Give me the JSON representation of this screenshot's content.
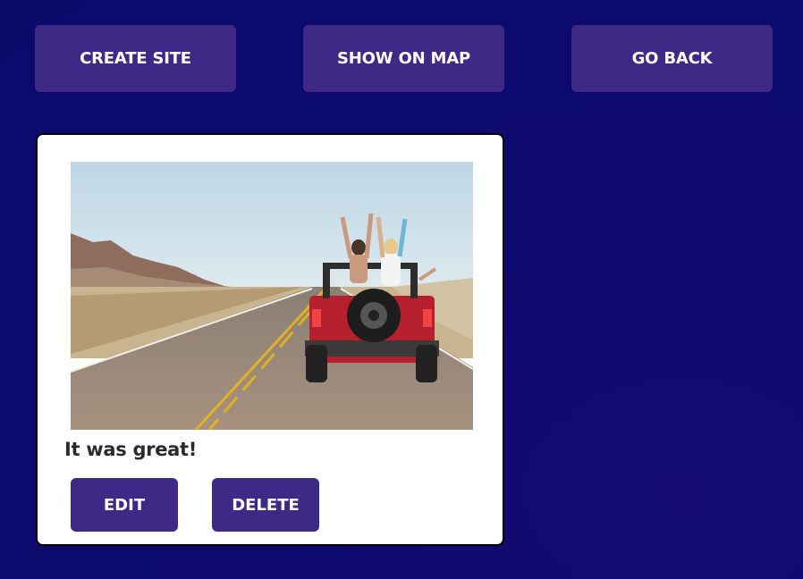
{
  "toolbar": {
    "create_label": "CREATE SITE",
    "map_label": "SHOW ON MAP",
    "back_label": "GO BACK"
  },
  "card": {
    "caption": "It was great!",
    "edit_label": "EDIT",
    "delete_label": "DELETE"
  },
  "colors": {
    "background": "#0b0a6b",
    "button": "#3e2a86",
    "card": "#ffffff"
  }
}
